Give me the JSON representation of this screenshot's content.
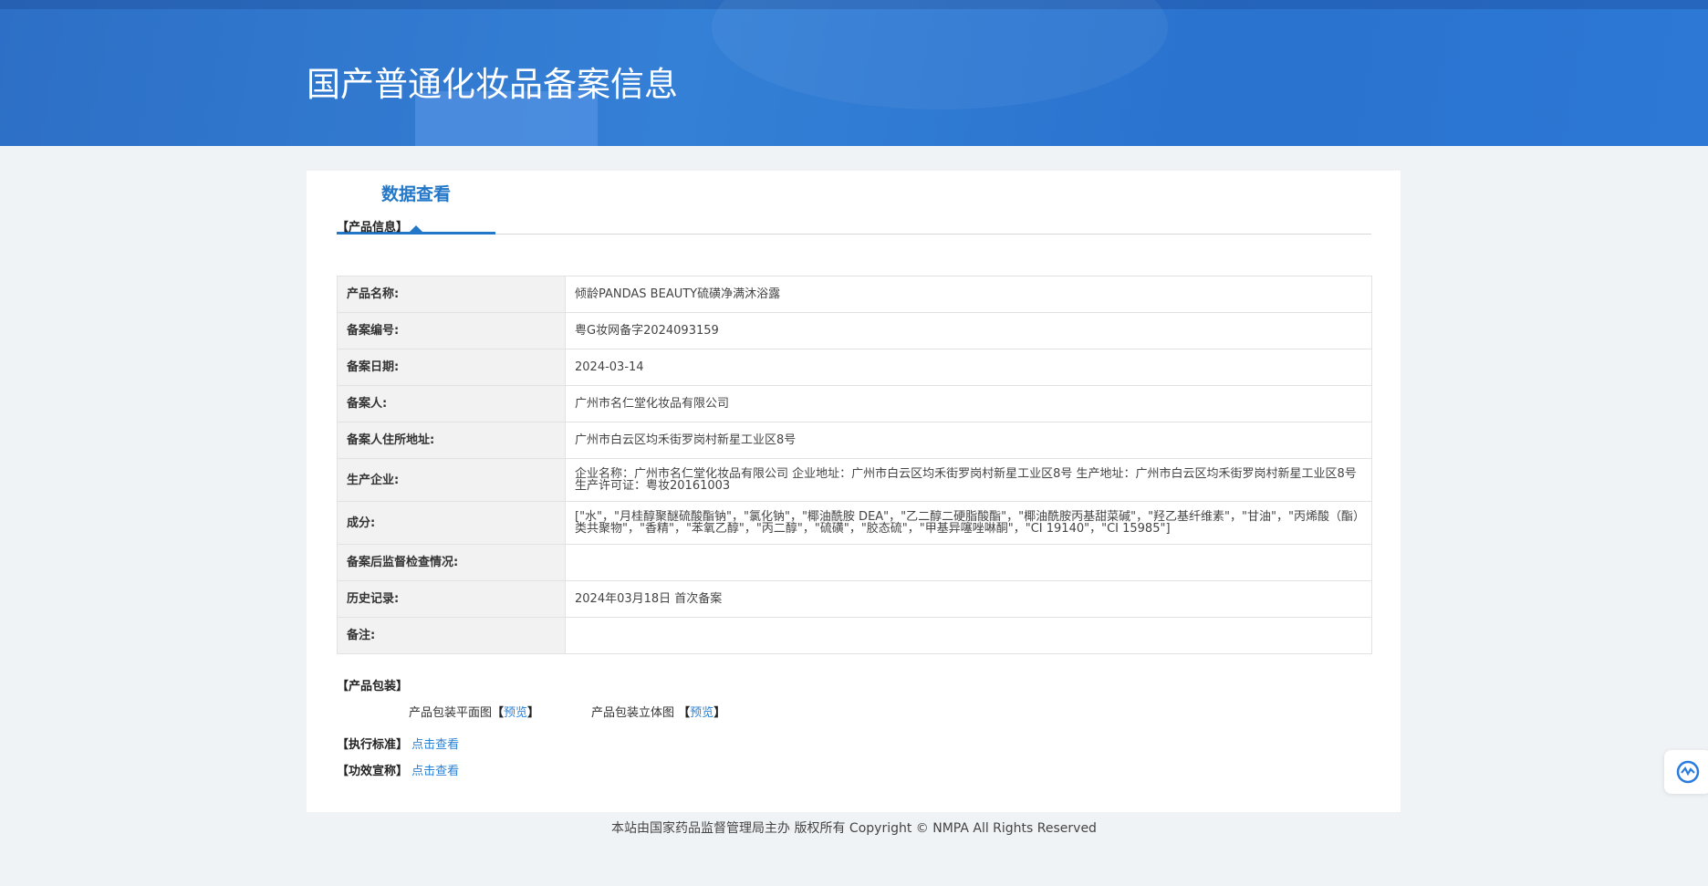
{
  "header": {
    "title": "国产普通化妆品备案信息"
  },
  "tab": {
    "label": "数据查看"
  },
  "product_info": {
    "section": "【产品信息】",
    "rows": [
      {
        "label": "产品名称:",
        "value": "倾龄PANDAS BEAUTY硫磺净满沐浴露"
      },
      {
        "label": "备案编号:",
        "value": "粤G妆网备字2024093159"
      },
      {
        "label": "备案日期:",
        "value": "2024-03-14"
      },
      {
        "label": "备案人:",
        "value": "广州市名仁堂化妆品有限公司"
      },
      {
        "label": "备案人住所地址:",
        "value": "广州市白云区均禾街罗岗村新星工业区8号"
      },
      {
        "label": "生产企业:",
        "value": "企业名称：广州市名仁堂化妆品有限公司 企业地址：广州市白云区均禾街罗岗村新星工业区8号 生产地址：广州市白云区均禾街罗岗村新星工业区8号 生产许可证：粤妆20161003"
      },
      {
        "label": "成分:",
        "value": "[\"水\"，\"月桂醇聚醚硫酸酯钠\"，\"氯化钠\"，\"椰油酰胺 DEA\"，\"乙二醇二硬脂酸酯\"，\"椰油酰胺丙基甜菜碱\"，\"羟乙基纤维素\"，\"甘油\"，\"丙烯酸（酯）类共聚物\"，\"香精\"，\"苯氧乙醇\"，\"丙二醇\"，\"硫磺\"，\"胶态硫\"，\"甲基异噻唑啉酮\"，\"CI 19140\"，\"CI 15985\"]"
      },
      {
        "label": "备案后监督检查情况:",
        "value": ""
      },
      {
        "label": "历史记录:",
        "value": "2024年03月18日 首次备案"
      },
      {
        "label": "备注:",
        "value": ""
      }
    ]
  },
  "packaging": {
    "section": "【产品包装】",
    "flat_label": "产品包装平面图",
    "flat_link": "预览",
    "solid_label": "产品包装立体图",
    "solid_link": "预览",
    "bracket_open": "【",
    "bracket_close": "】"
  },
  "standard": {
    "label": "【执行标准】",
    "link": "点击查看"
  },
  "efficacy": {
    "label": "【功效宣称】",
    "link": "点击查看"
  },
  "footer": {
    "text": "本站由国家药品监督管理局主办 版权所有 Copyright © NMPA All Rights Reserved"
  }
}
